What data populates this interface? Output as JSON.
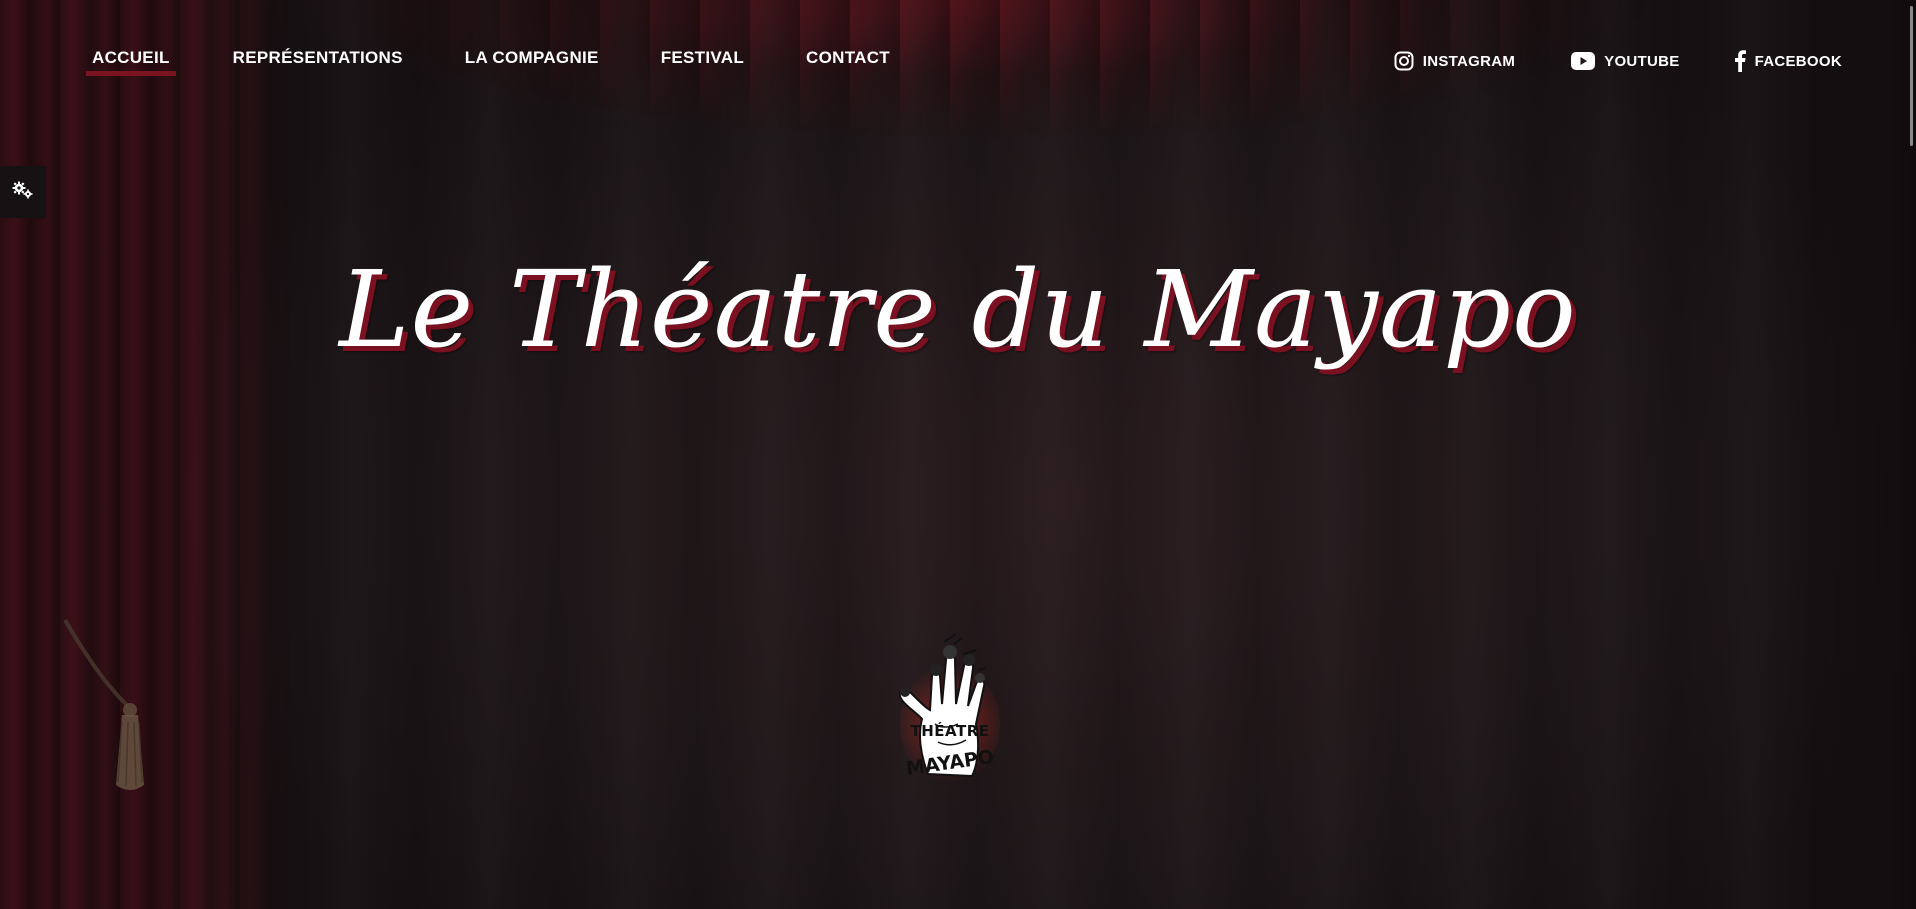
{
  "nav": {
    "items": [
      {
        "label": "ACCUEIL",
        "active": true
      },
      {
        "label": "REPRÉSENTATIONS",
        "active": false
      },
      {
        "label": "LA COMPAGNIE",
        "active": false
      },
      {
        "label": "FESTIVAL",
        "active": false
      },
      {
        "label": "CONTACT",
        "active": false
      }
    ]
  },
  "social": {
    "instagram": {
      "label": "INSTAGRAM",
      "icon": "instagram-icon"
    },
    "youtube": {
      "label": "YOUTUBE",
      "icon": "youtube-icon"
    },
    "facebook": {
      "label": "FACEBOOK",
      "icon": "facebook-icon"
    }
  },
  "settings": {
    "icon": "gears-icon"
  },
  "hero": {
    "title": "Le Théatre du Mayapo"
  },
  "logo": {
    "line1": "THÉATRE",
    "line2": "MAYAPO"
  },
  "colors": {
    "accent": "#7a1420",
    "background": "#1e1618",
    "text": "#ffffff"
  }
}
